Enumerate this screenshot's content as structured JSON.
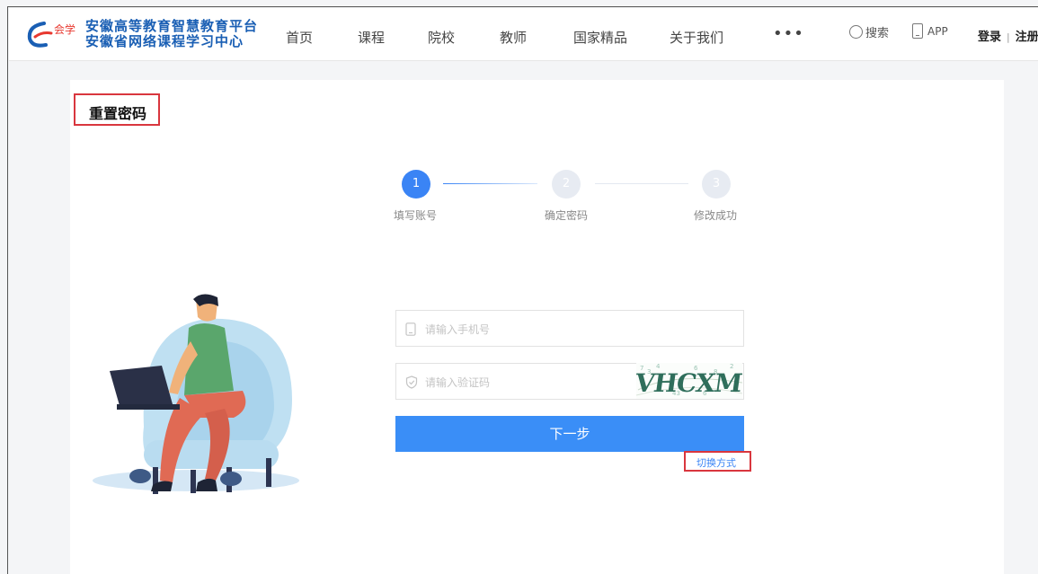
{
  "brand": {
    "line1": "安徽高等教育智慧教育平台",
    "line2": "安徽省网络课程学习中心"
  },
  "nav": [
    {
      "label": "首页"
    },
    {
      "label": "课程"
    },
    {
      "label": "院校"
    },
    {
      "label": "教师"
    },
    {
      "label": "国家精品"
    },
    {
      "label": "关于我们"
    },
    {
      "label": "•••"
    }
  ],
  "header": {
    "search_label": "搜索",
    "app_label": "APP",
    "login_label": "登录",
    "separator": "|",
    "register_label": "注册"
  },
  "page": {
    "title": "重置密码"
  },
  "steps": [
    {
      "number": "1",
      "label": "填写账号",
      "state": "active"
    },
    {
      "number": "2",
      "label": "确定密码",
      "state": "todo"
    },
    {
      "number": "3",
      "label": "修改成功",
      "state": "todo"
    }
  ],
  "form": {
    "phone_placeholder": "请输入手机号",
    "phone_value": "",
    "captcha_placeholder": "请输入验证码",
    "captcha_value": "",
    "captcha_text": "VHCXM",
    "next_label": "下一步",
    "switch_label": "切换方式"
  },
  "colors": {
    "accent": "#3a84f5",
    "highlight_border": "#d9363e",
    "brand_blue": "#1a5fb4"
  }
}
